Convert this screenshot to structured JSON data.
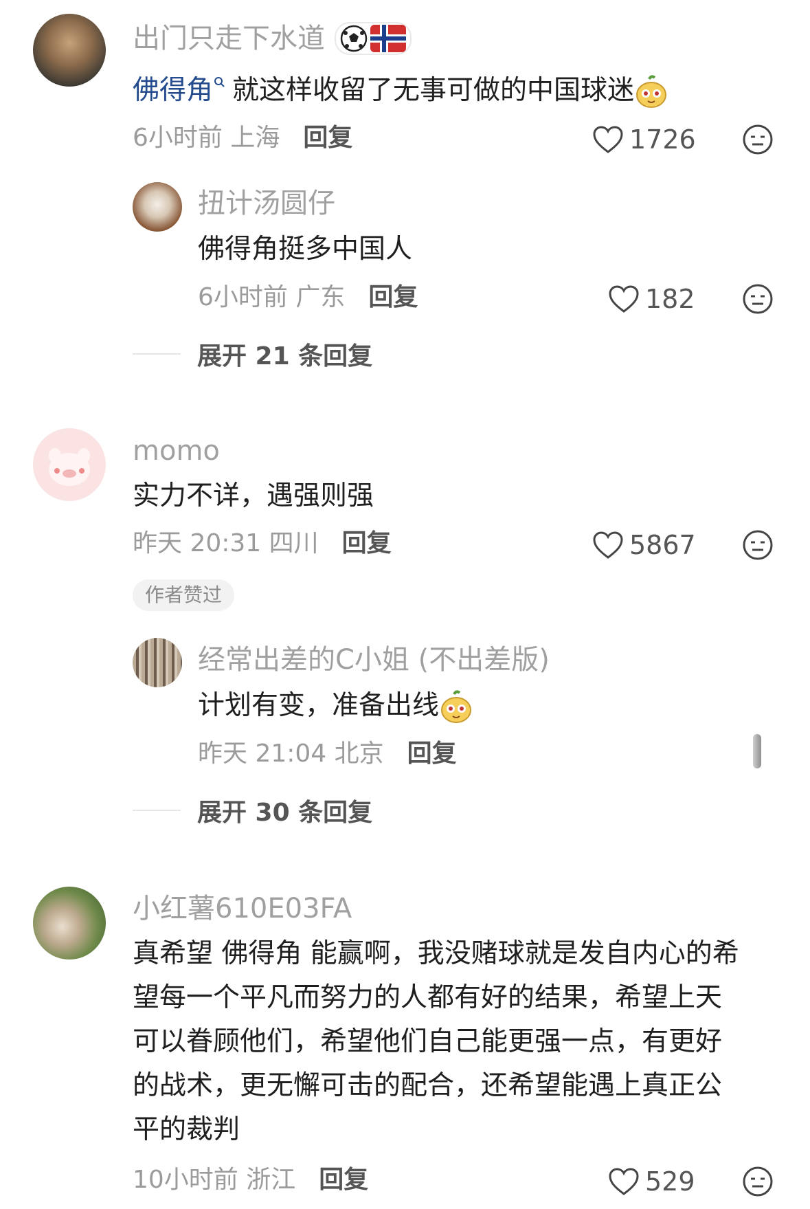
{
  "comments": [
    {
      "username": "出门只走下水道",
      "content_link": "佛得角",
      "content_text": "就这样收留了无事可做的中国球迷",
      "time_location": "6小时前 上海",
      "reply_label": "回复",
      "likes": "1726",
      "replies": [
        {
          "username": "扭计汤圆仔",
          "content": "佛得角挺多中国人",
          "time_location": "6小时前 广东",
          "reply_label": "回复",
          "likes": "182"
        }
      ],
      "expand_label": "展开 21 条回复"
    },
    {
      "username": "momo",
      "content": "实力不详，遇强则强",
      "time_location": "昨天 20:31 四川",
      "reply_label": "回复",
      "likes": "5867",
      "author_liked_tag": "作者赞过",
      "replies": [
        {
          "username": "经常出差的C小姐 (不出差版)",
          "content": "计划有变，准备出线",
          "time_location": "昨天 21:04 北京",
          "reply_label": "回复"
        }
      ],
      "expand_label": "展开 30 条回复"
    },
    {
      "username": "小红薯610E03FA",
      "content_lines": [
        "真希望 佛得角 能赢啊，我没赌球就是发自内心的希",
        "望每一个平凡而努力的人都有好的结果，希望上天",
        "可以眷顾他们，希望他们自己能更强一点，有更好",
        "的战术，更无懈可击的配合，还希望能遇上真正公",
        "平的裁判"
      ],
      "time_location": "10小时前 浙江",
      "reply_label": "回复",
      "likes": "529"
    }
  ],
  "icons": {
    "like": "heart-outline-icon",
    "dislike": "meh-face-icon",
    "search": "search-icon",
    "emoji": "mascot-emoji",
    "badge": "soccer-norway-badge"
  },
  "colors": {
    "link": "#234b8e",
    "name": "#a0a0a0",
    "meta": "#9b9b9b"
  }
}
